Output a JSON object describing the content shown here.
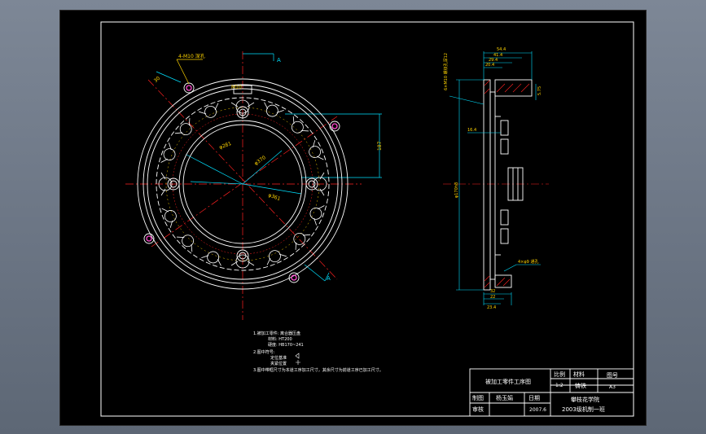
{
  "drawing": {
    "section_markers": {
      "top": "A",
      "bottom": "A"
    },
    "front_dims": {
      "thread": "M10",
      "callout": "4-M10 深孔",
      "angle": "30",
      "d1": "φ281",
      "d2": "φ370",
      "d3": "φ361",
      "height": "187"
    },
    "side_dims": {
      "top": [
        "54.4",
        "41.4",
        "29.4",
        "20.4"
      ],
      "note": "6×M10 螺纹孔深12",
      "right": "5.75",
      "left": "16.4",
      "dia": "φ170h8",
      "bottom_note": "4×φ9 通孔",
      "bottom": [
        "32",
        "22",
        "23.4"
      ]
    },
    "notes": {
      "n1": "1.被加工零件: 离合器压盘",
      "n1a": "材料: HT200",
      "n1b": "硬度: HB170~241",
      "n2": "2.图中符号:",
      "n2a": "定位基准",
      "n2b": "夹紧位置",
      "n3": "3.图中带框尺寸为本道工序加工尺寸，其余尺寸为前道工序已加工尺寸。"
    }
  },
  "title_block": {
    "name": "被加工零件工序图",
    "ratio_label": "比例",
    "ratio": "1:2",
    "material_label": "材料",
    "material": "铸铁",
    "drawing_no_label": "图号",
    "drawing_no": "A3",
    "drafted_label": "制图",
    "drafter": "杨玉娟",
    "date_label": "日期",
    "reviewed_label": "审核",
    "date": "2007.6",
    "school": "攀枝花学院",
    "class": "2003级机制一班"
  }
}
